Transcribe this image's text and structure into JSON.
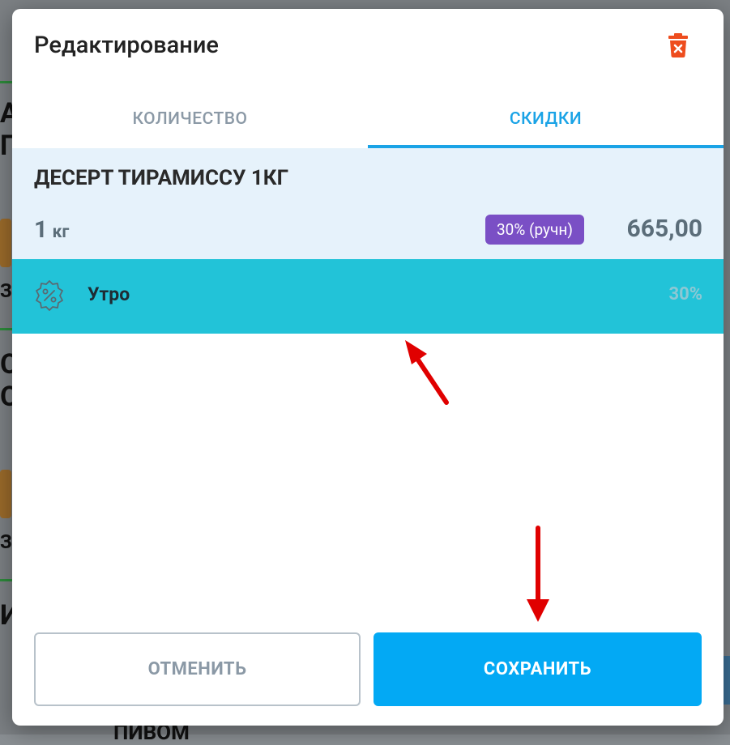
{
  "dialog": {
    "title": "Редактирование",
    "delete_icon": "trash-icon"
  },
  "tabs": [
    {
      "label": "КОЛИЧЕСТВО",
      "active": false
    },
    {
      "label": "СКИДКИ",
      "active": true
    }
  ],
  "item": {
    "name": "ДЕСЕРТ ТИРАМИССУ  1КГ",
    "quantity": "1",
    "unit": "кг",
    "discount_badge": "30% (ручн)",
    "price": "665,00"
  },
  "discount": {
    "icon": "percent-badge-icon",
    "name": "Утро",
    "percent": "30%"
  },
  "buttons": {
    "cancel": "ОТМЕНИТЬ",
    "save": "СОХРАНИТЬ"
  },
  "background_fragments": [
    "А",
    "Г",
    "З",
    "О",
    "О",
    "З",
    "И",
    "ПИВОМ"
  ],
  "colors": {
    "accent": "#1aa3e6",
    "save_button": "#03a9f4",
    "badge": "#7a4fc5",
    "discount_row": "#22c3d8",
    "delete": "#ee4d1e",
    "annotation_arrow": "#e00000"
  }
}
